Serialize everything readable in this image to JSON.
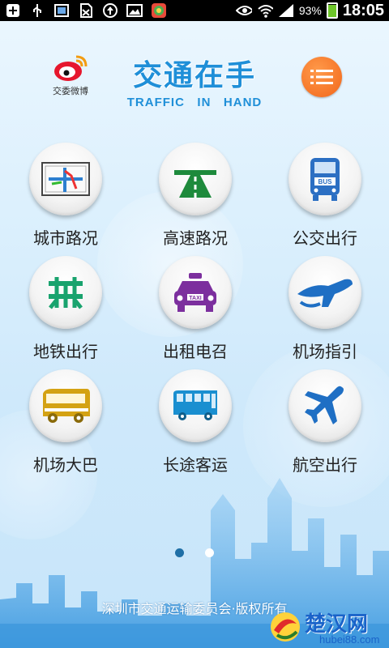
{
  "status_bar": {
    "battery_percent": "93%",
    "battery_level": 0.93,
    "time": "18:05",
    "icons_left": [
      "plus-icon",
      "usb-icon",
      "screenshot-icon",
      "no-sim-icon",
      "upload-icon",
      "image-icon",
      "app-store-icon"
    ],
    "icons_right": [
      "eye-icon",
      "wifi-icon",
      "signal-icon",
      "battery-icon"
    ]
  },
  "header": {
    "weibo_label": "交委微博",
    "title_cn": "交通在手",
    "title_en": "TRAFFIC   IN   HAND",
    "menu_icon": "menu-list-icon"
  },
  "tiles": [
    {
      "label": "城市路况",
      "icon": "city-traffic-icon"
    },
    {
      "label": "高速路况",
      "icon": "highway-icon"
    },
    {
      "label": "公交出行",
      "icon": "bus-icon"
    },
    {
      "label": "地铁出行",
      "icon": "metro-icon"
    },
    {
      "label": "出租电召",
      "icon": "taxi-icon"
    },
    {
      "label": "机场指引",
      "icon": "airport-guide-icon"
    },
    {
      "label": "机场大巴",
      "icon": "airport-coach-icon"
    },
    {
      "label": "长途客运",
      "icon": "long-distance-bus-icon"
    },
    {
      "label": "航空出行",
      "icon": "airplane-icon"
    }
  ],
  "pager": {
    "pages": 2,
    "current": 1
  },
  "footer": {
    "text": "深圳市交通运输委员会·版权所有"
  },
  "watermark": {
    "text": "楚汉网",
    "sub": "hubei88.com"
  },
  "colors": {
    "brand_blue": "#1f8fd8",
    "menu_orange": "#f2661a",
    "battery_green": "#6ec62a"
  }
}
